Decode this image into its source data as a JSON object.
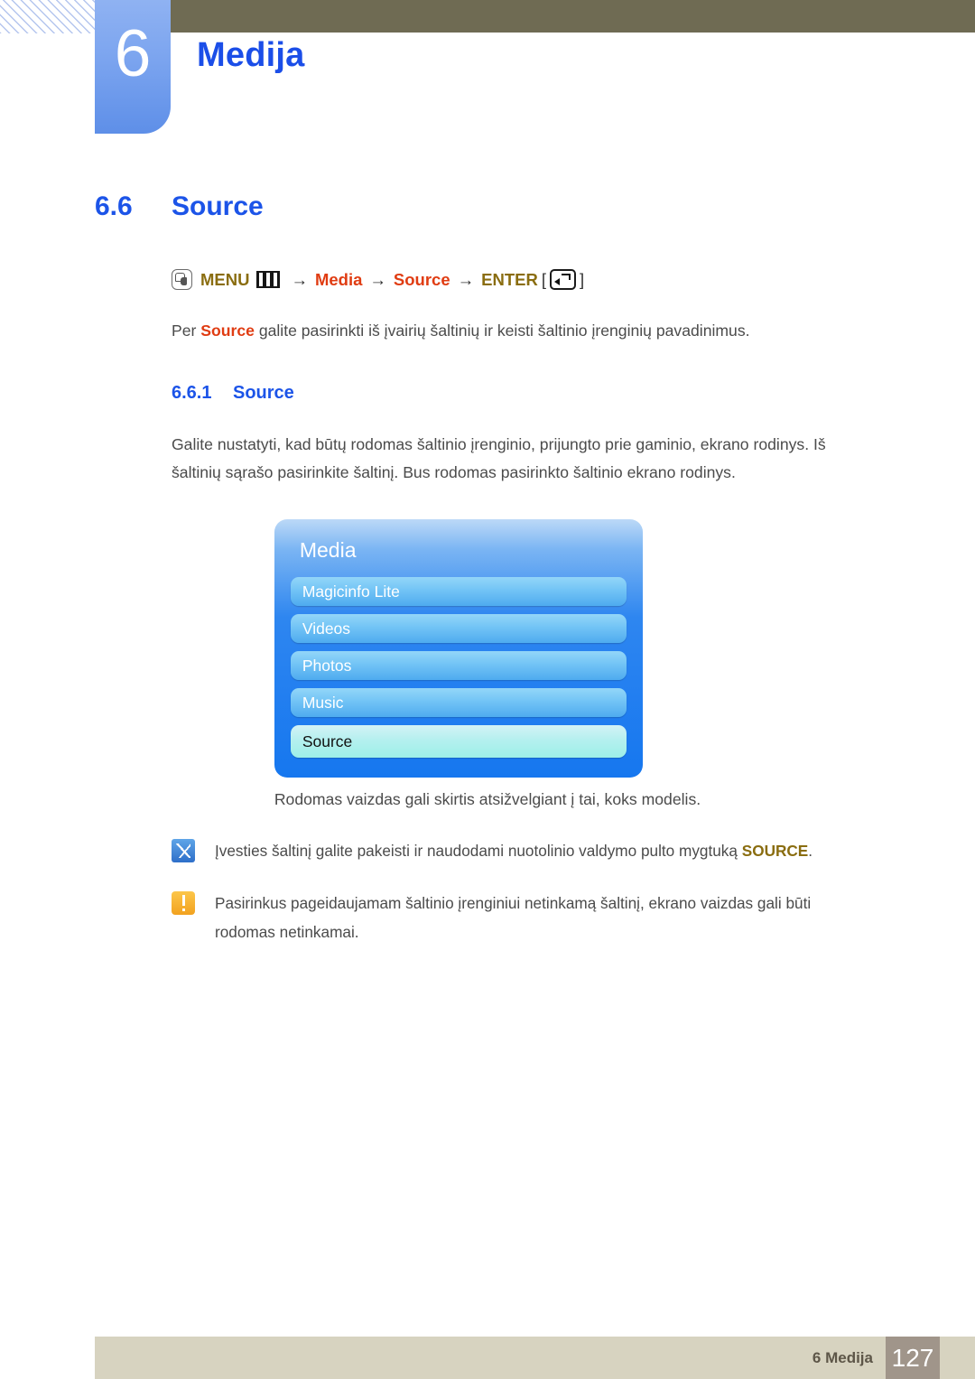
{
  "header": {
    "chapter_number": "6",
    "chapter_title": "Medija",
    "accent_blue": "#1b4ee8",
    "badge_blue": "#7ba4ef",
    "olive": "#6f6b53"
  },
  "section": {
    "number": "6.6",
    "title": "Source"
  },
  "menu_path": {
    "press_icon": "press-button-icon",
    "menu_label": "MENU",
    "menu_bars_icon": "menu-bars-icon",
    "arrow1": "→",
    "media_label": "Media",
    "arrow2": "→",
    "source_label": "Source",
    "arrow3": "→",
    "enter_label": "ENTER",
    "bracket_open": "[",
    "enter_icon": "enter-key-icon",
    "bracket_close": "]",
    "gold": "#8a6d10",
    "red": "#e03c12"
  },
  "intro": {
    "before": "Per ",
    "highlight": "Source",
    "after": " galite pasirinkti iš įvairių šaltinių ir keisti šaltinio įrenginių pavadinimus."
  },
  "subsection": {
    "number": "6.6.1",
    "title": "Source"
  },
  "description": "Galite nustatyti, kad būtų rodomas šaltinio įrenginio, prijungto prie gaminio, ekrano rodinys. Iš šaltinių sąrašo pasirinkite šaltinį. Bus rodomas pasirinkto šaltinio ekrano rodinys.",
  "osd": {
    "title": "Media",
    "items": [
      {
        "label": "Magicinfo Lite",
        "selected": false
      },
      {
        "label": "Videos",
        "selected": false
      },
      {
        "label": "Photos",
        "selected": false
      },
      {
        "label": "Music",
        "selected": false
      },
      {
        "label": "Source",
        "selected": true
      }
    ],
    "caption": "Rodomas vaizdas gali skirtis atsižvelgiant į tai, koks modelis.",
    "panel_blue": "#1677ef",
    "item_blue": "#76c6f6",
    "selected_cyan": "#b5f0ef"
  },
  "notes": [
    {
      "icon": "note-pen-icon",
      "before": "Įvesties šaltinį galite pakeisti ir naudodami nuotolinio valdymo pulto mygtuką ",
      "highlight": "SOURCE",
      "after": "."
    },
    {
      "icon": "warning-exclamation-icon",
      "before": "Pasirinkus pageidaujamam šaltinio įrenginiui netinkamą šaltinį, ekrano vaizdas gali būti rodomas netinkamai.",
      "highlight": "",
      "after": ""
    }
  ],
  "footer": {
    "label": "6 Medija",
    "page_number": "127",
    "bar_color": "#d7d3c0",
    "page_box_color": "#a0958a"
  }
}
